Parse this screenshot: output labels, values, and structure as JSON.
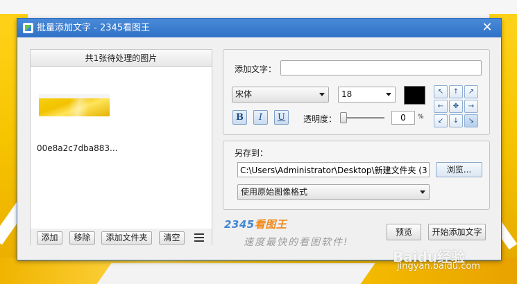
{
  "window": {
    "title": "批量添加文字 - 2345看图王"
  },
  "left_panel": {
    "header": "共1张待处理的图片",
    "items": [
      {
        "filename": "00e8a2c7dba883..."
      }
    ],
    "buttons": {
      "add": "添加",
      "remove": "移除",
      "add_folder": "添加文件夹",
      "clear": "清空"
    }
  },
  "text_settings": {
    "label": "添加文字：",
    "value": "",
    "font": "宋体",
    "font_size": "18",
    "color": "#000000",
    "bold": "B",
    "italic": "I",
    "underline": "U",
    "opacity_label": "透明度：",
    "opacity_value": "0",
    "opacity_unit": "%",
    "position_grid": [
      "↖",
      "↑",
      "↗",
      "←",
      "✥",
      "→",
      "↙",
      "↓",
      "↘"
    ],
    "selected_position": "bottom-right"
  },
  "save_settings": {
    "label": "另存到：",
    "path": "C:\\Users\\Administrator\\Desktop\\新建文件夹 (3",
    "browse": "浏览...",
    "format": "使用原始图像格式"
  },
  "brand": {
    "name_digits": "2345",
    "name_text": "看图王",
    "slogan": "速度最快的看图软件!"
  },
  "actions": {
    "preview": "预览",
    "start": "开始添加文字"
  },
  "watermark": {
    "main": "Baidu经验",
    "sub": "jingyan.baidu.com"
  }
}
